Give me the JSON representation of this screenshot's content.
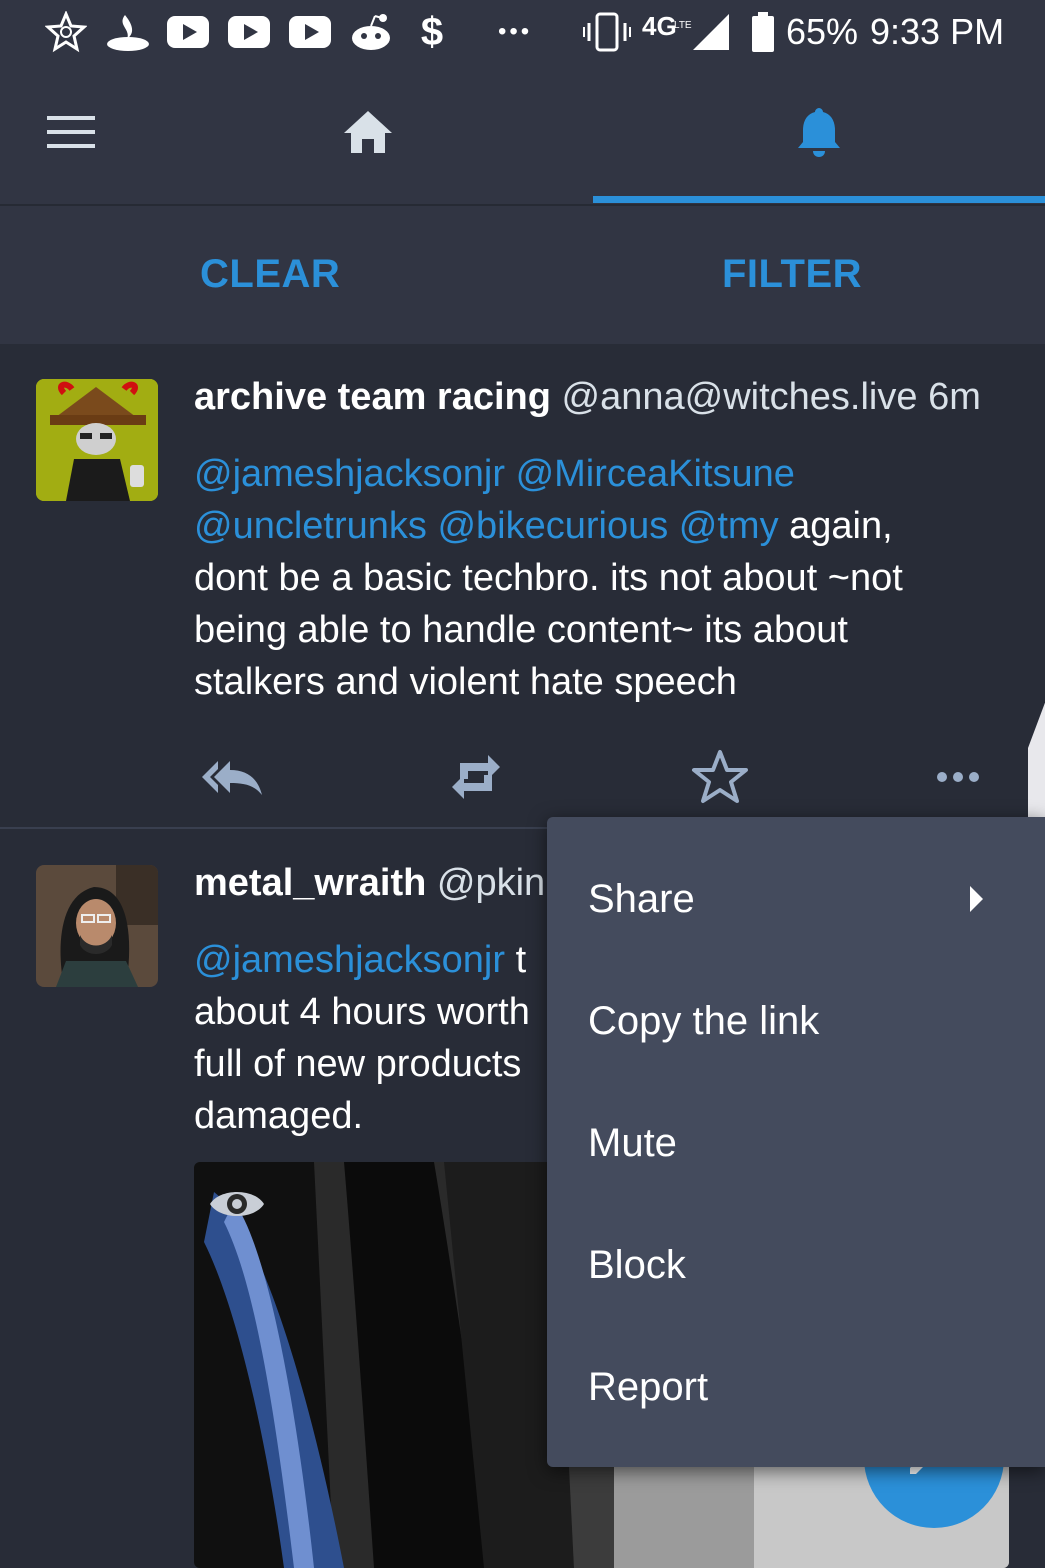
{
  "statusbar": {
    "battery": "65%",
    "time": "9:33 PM",
    "network": "4G",
    "network_sub": "LTE",
    "overflow": "•••",
    "left_icons": [
      "app-star-icon",
      "santander-icon",
      "youtube-icon",
      "youtube-icon",
      "youtube-icon",
      "reddit-icon",
      "dollar-icon"
    ]
  },
  "nav": {
    "tabs": [
      {
        "name": "menu",
        "icon": "hamburger-icon"
      },
      {
        "name": "home",
        "icon": "home-icon"
      },
      {
        "name": "notifications",
        "icon": "bell-icon",
        "active": true
      }
    ],
    "accent": "#2b90d9"
  },
  "actionbar": {
    "clear_label": "CLEAR",
    "filter_label": "FILTER"
  },
  "statuses": [
    {
      "display_name": "archive team racing",
      "acct": "@anna@witches.live",
      "time": "6m",
      "mentions_line1": "@jameshjacksonjr @MirceaKitsune",
      "mentions_line2": "@uncletrunks @bikecurious @tmy",
      "text_line2_tail": " again,",
      "text_line3": "dont be a basic techbro. its not about ~not",
      "text_line4": "being able to handle content~ its about",
      "text_line5": "stalkers and violent hate speech"
    },
    {
      "display_name": "metal_wraith",
      "acct": "@pkin",
      "mention": "@jameshjacksonjr",
      "mention_tail": " t",
      "text_line2": "about 4 hours worth",
      "text_line3": "full of new products",
      "text_line4": "damaged."
    }
  ],
  "menu": {
    "items": [
      {
        "label": "Share",
        "has_submenu": true
      },
      {
        "label": "Copy the link"
      },
      {
        "label": "Mute"
      },
      {
        "label": "Block"
      },
      {
        "label": "Report"
      }
    ]
  }
}
